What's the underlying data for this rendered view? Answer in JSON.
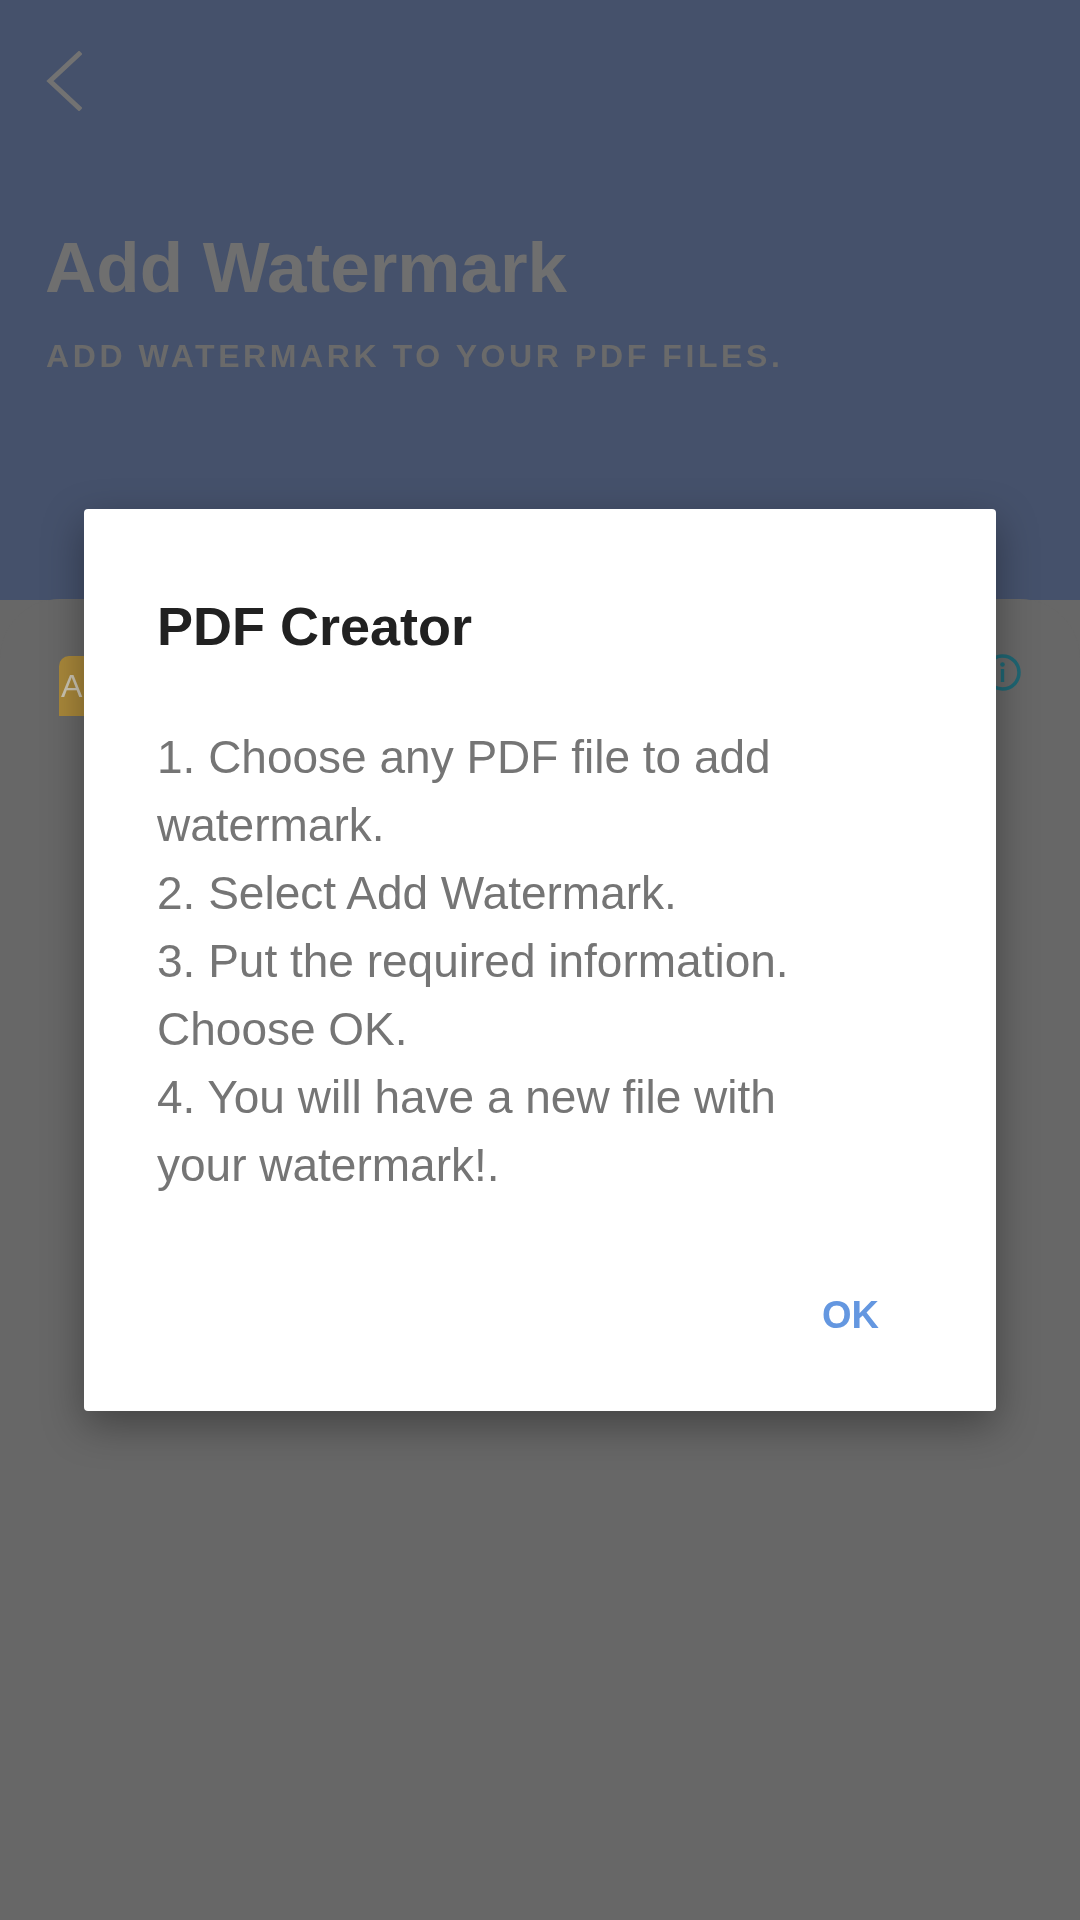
{
  "header": {
    "title": "Add Watermark",
    "subtitle": "ADD WATERMARK TO YOUR PDF FILES."
  },
  "card": {
    "tile_letter": "A"
  },
  "dialog": {
    "title": "PDF Creator",
    "steps": [
      "1. Choose any PDF file to add watermark.",
      "2. Select Add Watermark.",
      "3. Put the required information. Choose OK.",
      "4. You will have a new file with your watermark!."
    ],
    "buttons": [
      "OK"
    ]
  }
}
